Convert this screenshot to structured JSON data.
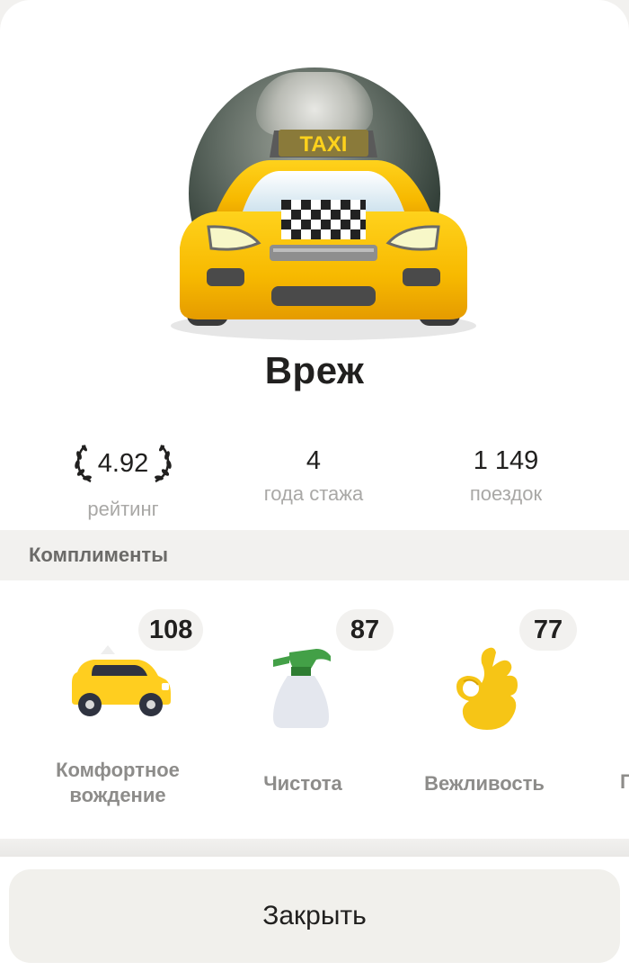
{
  "driver": {
    "name": "Врéж"
  },
  "stats": {
    "rating": {
      "value": "4.92",
      "label": "рейтинг"
    },
    "experience": {
      "value": "4",
      "label": "года стажа"
    },
    "trips": {
      "value": "1 149",
      "label": "поездок"
    }
  },
  "compliments": {
    "title": "Комплименты",
    "items": [
      {
        "count": "108",
        "label": "Комфортное вождение",
        "icon": "comfortable-driving-car-icon"
      },
      {
        "count": "87",
        "label": "Чистота",
        "icon": "spray-bottle-icon"
      },
      {
        "count": "77",
        "label": "Вежливость",
        "icon": "ok-hand-icon"
      }
    ],
    "next_partial_label": "П"
  },
  "footer": {
    "close_label": "Закрыть"
  },
  "avatar": {
    "overlay_text": "TAXI",
    "overlay_icon": "taxi-car-emoji-icon"
  },
  "colors": {
    "background": "#ffffff",
    "section_bg": "#f2f1ef",
    "taxi_yellow": "#f7b900",
    "accent_text": "#21201f",
    "muted_text": "#a9a8a6"
  }
}
